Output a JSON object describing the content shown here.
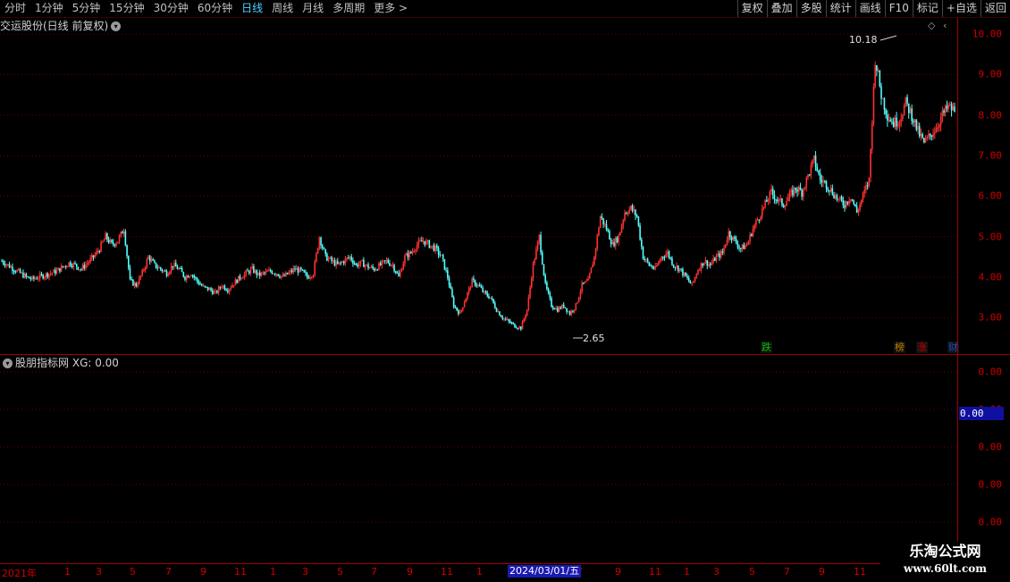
{
  "toolbar": {
    "periods": [
      "分时",
      "1分钟",
      "5分钟",
      "15分钟",
      "30分钟",
      "60分钟",
      "日线",
      "周线",
      "月线",
      "多周期",
      "更多 >"
    ],
    "active_period": "日线",
    "buttons": [
      "复权",
      "叠加",
      "多股",
      "统计",
      "画线",
      "F10",
      "标记",
      "+自选",
      "返回"
    ]
  },
  "main_panel": {
    "title": "交运股份(日线 前复权)",
    "high_label": "10.18",
    "low_label": "2.65",
    "y_ticks": [
      "10.00",
      "9.00",
      "8.00",
      "7.00",
      "6.00",
      "5.00",
      "4.00",
      "3.00"
    ]
  },
  "indicator_panel": {
    "title": "股朋指标网",
    "value_text": "XG: 0.00",
    "y_ticks": [
      "0.00",
      "0.00",
      "0.00",
      "0.00",
      "0.00"
    ],
    "current_value": "0.00"
  },
  "event_markers": [
    {
      "text": "跌",
      "color": "#00c000"
    },
    {
      "text": "榜",
      "color": "#c08000"
    },
    {
      "text": "涨",
      "color": "#c00000"
    },
    {
      "text": "财",
      "color": "#2050c0"
    }
  ],
  "x_axis": {
    "labels": [
      "2021年",
      "1",
      "3",
      "5",
      "7",
      "9",
      "11",
      "1",
      "3",
      "5",
      "7",
      "9",
      "11",
      "1",
      "7",
      "9",
      "11",
      "1",
      "3",
      "5",
      "7",
      "9",
      "11"
    ],
    "selected_date": "2024/03/01/五"
  },
  "watermark": {
    "line1": "乐淘公式网",
    "line2": "www.60lt.com"
  },
  "chart_data": {
    "type": "candlestick",
    "y_range": [
      2.5,
      10.4
    ],
    "colors": {
      "up": "#ff3232",
      "down": "#54ffff"
    },
    "closes": [
      4.4,
      4.3,
      4.2,
      4.1,
      4.0,
      3.95,
      4.0,
      4.05,
      4.1,
      4.15,
      4.25,
      4.35,
      4.3,
      4.2,
      4.35,
      4.5,
      4.7,
      5.0,
      4.8,
      4.9,
      5.2,
      3.9,
      3.8,
      4.1,
      4.5,
      4.3,
      4.2,
      4.1,
      4.3,
      4.2,
      4.0,
      4.1,
      3.9,
      3.75,
      3.7,
      3.6,
      3.8,
      3.7,
      3.85,
      4.0,
      4.1,
      4.2,
      4.05,
      4.1,
      4.15,
      4.1,
      4.0,
      4.1,
      4.2,
      4.15,
      4.0,
      4.1,
      5.0,
      4.5,
      4.4,
      4.3,
      4.4,
      4.5,
      4.3,
      4.35,
      4.25,
      4.2,
      4.3,
      4.4,
      4.3,
      4.0,
      4.5,
      4.6,
      4.8,
      4.9,
      4.8,
      4.7,
      4.5,
      4.0,
      3.3,
      3.1,
      3.5,
      3.9,
      3.8,
      3.6,
      3.5,
      3.2,
      3.0,
      2.9,
      2.8,
      2.75,
      3.2,
      4.3,
      5.0,
      3.8,
      3.3,
      3.2,
      3.3,
      3.1,
      3.3,
      3.8,
      3.9,
      4.5,
      5.5,
      5.2,
      4.8,
      5.0,
      5.6,
      5.7,
      5.5,
      4.5,
      4.3,
      4.2,
      4.5,
      4.6,
      4.3,
      4.2,
      4.0,
      3.8,
      4.2,
      4.4,
      4.3,
      4.5,
      4.6,
      5.1,
      4.9,
      4.7,
      4.8,
      5.2,
      5.5,
      5.8,
      6.1,
      5.9,
      5.8,
      6.0,
      6.2,
      6.1,
      6.5,
      6.9,
      6.4,
      6.3,
      6.1,
      5.9,
      5.8,
      6.0,
      5.6,
      6.0,
      6.4,
      9.4,
      8.5,
      8.0,
      7.8,
      7.9,
      8.3,
      8.0,
      7.6,
      7.3,
      7.5,
      7.7,
      8.0,
      8.2,
      8.1
    ]
  }
}
